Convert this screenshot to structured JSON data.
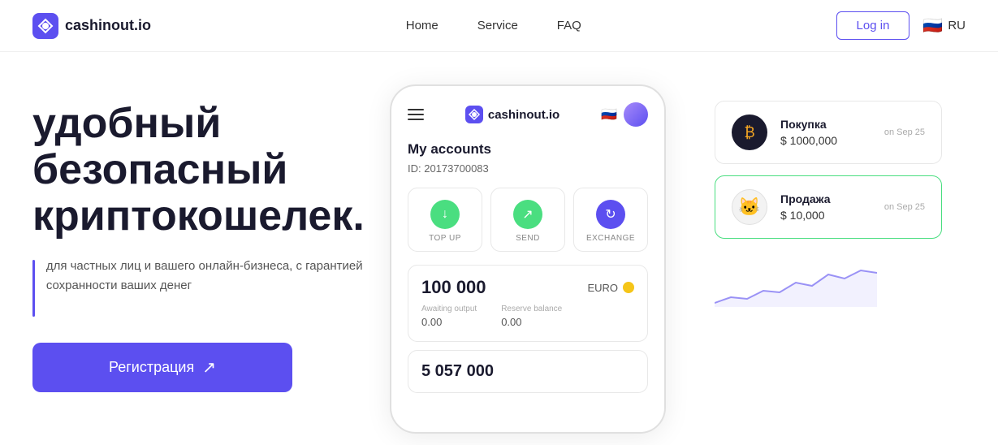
{
  "header": {
    "logo_text": "cashinout.io",
    "nav": [
      {
        "label": "Home",
        "id": "home"
      },
      {
        "label": "Service",
        "id": "service"
      },
      {
        "label": "FAQ",
        "id": "faq"
      }
    ],
    "login_label": "Log in",
    "lang_code": "RU"
  },
  "hero": {
    "title_line1": "удобный",
    "title_line2": "безопасный",
    "title_line3": "криптокошелек.",
    "description": "для частных лиц и вашего онлайн-бизнеса, с гарантией сохранности ваших денег",
    "register_label": "Регистрация"
  },
  "phone": {
    "logo_text": "cashinout.io",
    "my_accounts_label": "My accounts",
    "account_id": "ID: 20173700083",
    "actions": [
      {
        "label": "TOP UP",
        "type": "topup",
        "icon": "↓"
      },
      {
        "label": "SEND",
        "type": "send",
        "icon": "↗"
      },
      {
        "label": "EXCHANGE",
        "type": "exchange",
        "icon": "↻"
      }
    ],
    "balance1": {
      "amount": "100 000",
      "currency": "EURO",
      "awaiting_label": "Awaiting output",
      "awaiting_value": "0.00",
      "reserve_label": "Reserve balance",
      "reserve_value": "0.00"
    },
    "balance2": {
      "amount": "5 057 000"
    }
  },
  "transactions": [
    {
      "type": "buy",
      "title": "Покупка",
      "amount": "$ 1000,000",
      "date": "on Sep 25",
      "icon": "₿"
    },
    {
      "type": "sell",
      "title": "Продажа",
      "amount": "$ 10,000",
      "date": "on Sep 25",
      "icon": "🐱"
    }
  ]
}
